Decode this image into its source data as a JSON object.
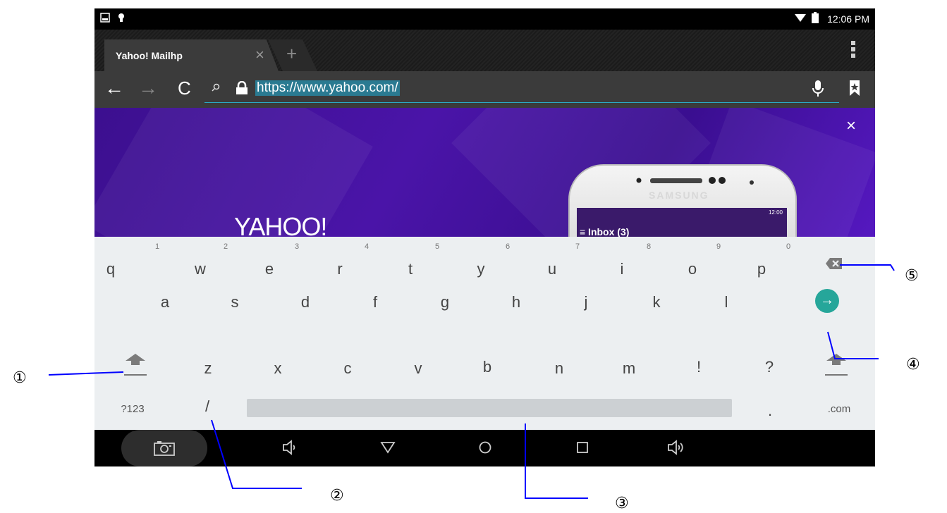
{
  "status_bar": {
    "time": "12:06 PM"
  },
  "browser": {
    "tab": {
      "title": "Yahoo! Mailhp",
      "close": "×",
      "new_tab": "+"
    },
    "url": "https://www.yahoo.com/"
  },
  "web": {
    "logo": "YAHOO!",
    "banner_close": "×",
    "phone": {
      "brand": "SAMSUNG",
      "status_time": "12:00",
      "inbox": "≡ Inbox (3)"
    }
  },
  "keyboard": {
    "row1": [
      {
        "key": "q",
        "hint": "1"
      },
      {
        "key": "w",
        "hint": "2"
      },
      {
        "key": "e",
        "hint": "3"
      },
      {
        "key": "r",
        "hint": "4"
      },
      {
        "key": "t",
        "hint": "5"
      },
      {
        "key": "y",
        "hint": "6"
      },
      {
        "key": "u",
        "hint": "7"
      },
      {
        "key": "i",
        "hint": "8"
      },
      {
        "key": "o",
        "hint": "9"
      },
      {
        "key": "p",
        "hint": "0"
      }
    ],
    "row2": [
      "a",
      "s",
      "d",
      "f",
      "g",
      "h",
      "j",
      "k",
      "l"
    ],
    "row3": [
      "z",
      "x",
      "c",
      "v",
      "b",
      "n",
      "m",
      "!",
      "?"
    ],
    "row4": {
      "symbols": "?123",
      "slash": "/",
      "period": ".",
      "dotcom": ".com"
    }
  },
  "callouts": [
    "①",
    "②",
    "③",
    "④",
    "⑤"
  ],
  "colors": {
    "go_button": "#26a69a",
    "url_underline": "#2aa8c4",
    "callout_line": "#0000ff"
  }
}
